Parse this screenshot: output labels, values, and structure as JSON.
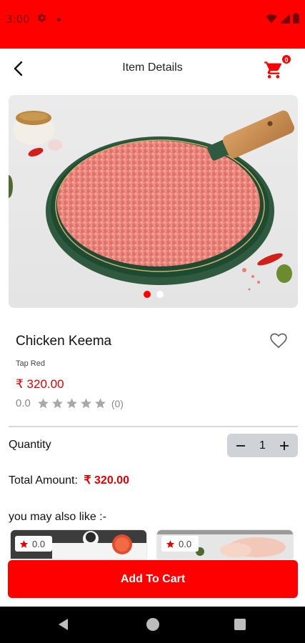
{
  "status_bar": {
    "time": "3:00",
    "icons": [
      "gear-icon",
      "notification-dot",
      "wifi-icon",
      "signal-icon",
      "battery-icon"
    ]
  },
  "app_bar": {
    "title": "Item Details",
    "cart_count": "0"
  },
  "colors": {
    "accent": "#ff0000",
    "price": "#e30000",
    "stepper_bg": "#cfd3d8"
  },
  "carousel": {
    "slide_count": 2,
    "active_index": 0
  },
  "product": {
    "name": "Chicken Keema",
    "brand": "Tap Red",
    "price": "₹ 320.00",
    "rating_value": "0.0",
    "rating_stars": 0,
    "rating_count": "(0)"
  },
  "quantity": {
    "label": "Quantity",
    "value": "1",
    "minus": "−",
    "plus": "+"
  },
  "total": {
    "label": "Total Amount:",
    "amount": "₹ 320.00"
  },
  "recommendations": {
    "heading": "you may also like :-",
    "items": [
      {
        "rating": "0.0"
      },
      {
        "rating": "0.0"
      }
    ]
  },
  "actions": {
    "add_to_cart": "Add To Cart"
  }
}
